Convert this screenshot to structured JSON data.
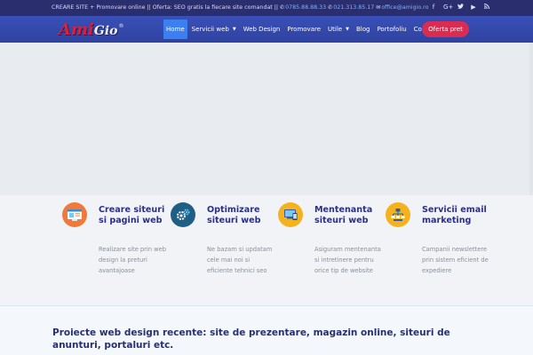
{
  "topbar": {
    "promo_text": "CREARE SITE + Promovare online || Oferta: SEO gratis la fiecare site comandat ||",
    "phone1": "0785.88.88.33",
    "phone2": "021.313.85.17",
    "email": "office@amigio.ro",
    "social_icons": [
      "facebook-icon",
      "google-plus-icon",
      "twitter-icon",
      "youtube-icon",
      "rss-icon"
    ]
  },
  "header": {
    "logo_part1": "Ami",
    "logo_part2": "Gio",
    "logo_reg": "®",
    "menu": [
      {
        "label": "Home",
        "active": true,
        "has_dropdown": false
      },
      {
        "label": "Servicii web",
        "active": false,
        "has_dropdown": true
      },
      {
        "label": "Web Design",
        "active": false,
        "has_dropdown": false
      },
      {
        "label": "Promovare",
        "active": false,
        "has_dropdown": false
      },
      {
        "label": "Utile",
        "active": false,
        "has_dropdown": true
      },
      {
        "label": "Blog",
        "active": false,
        "has_dropdown": false
      },
      {
        "label": "Portofoliu",
        "active": false,
        "has_dropdown": false
      },
      {
        "label": "Contact",
        "active": false,
        "has_dropdown": false
      }
    ],
    "cta_label": "Oferta pret"
  },
  "services": [
    {
      "title": "Creare siteuri si pagini web",
      "desc": "Realizare site prin web design la preturi avantajoase",
      "icon": "website-creation-icon",
      "icon_bg": "#f07a3a"
    },
    {
      "title": "Optimizare siteuri web",
      "desc": "Ne bazam si updatam cele mai noi si eficiente tehnici seo",
      "icon": "gears-icon",
      "icon_bg": "#1f5f86"
    },
    {
      "title": "Mentenanta siteuri web",
      "desc": "Asiguram mentenanta si intretinere pentru orice tip de website",
      "icon": "devices-icon",
      "icon_bg": "#f5b21e"
    },
    {
      "title": "Servicii email marketing",
      "desc": "Campanii newslettere prin sistem eficient de expediere",
      "icon": "email-network-icon",
      "icon_bg": "#f5b21e"
    }
  ],
  "projects": {
    "heading": "Proiecte web design recente: site de prezentare, magazin online, siteuri de anunturi, portaluri etc."
  },
  "colors": {
    "topbar_bg": "#2a2e6e",
    "nav_bg": "#3447a8",
    "active_item": "#3b7ff0",
    "cta_bg": "#d92c53",
    "heading_color": "#2b2f86"
  }
}
